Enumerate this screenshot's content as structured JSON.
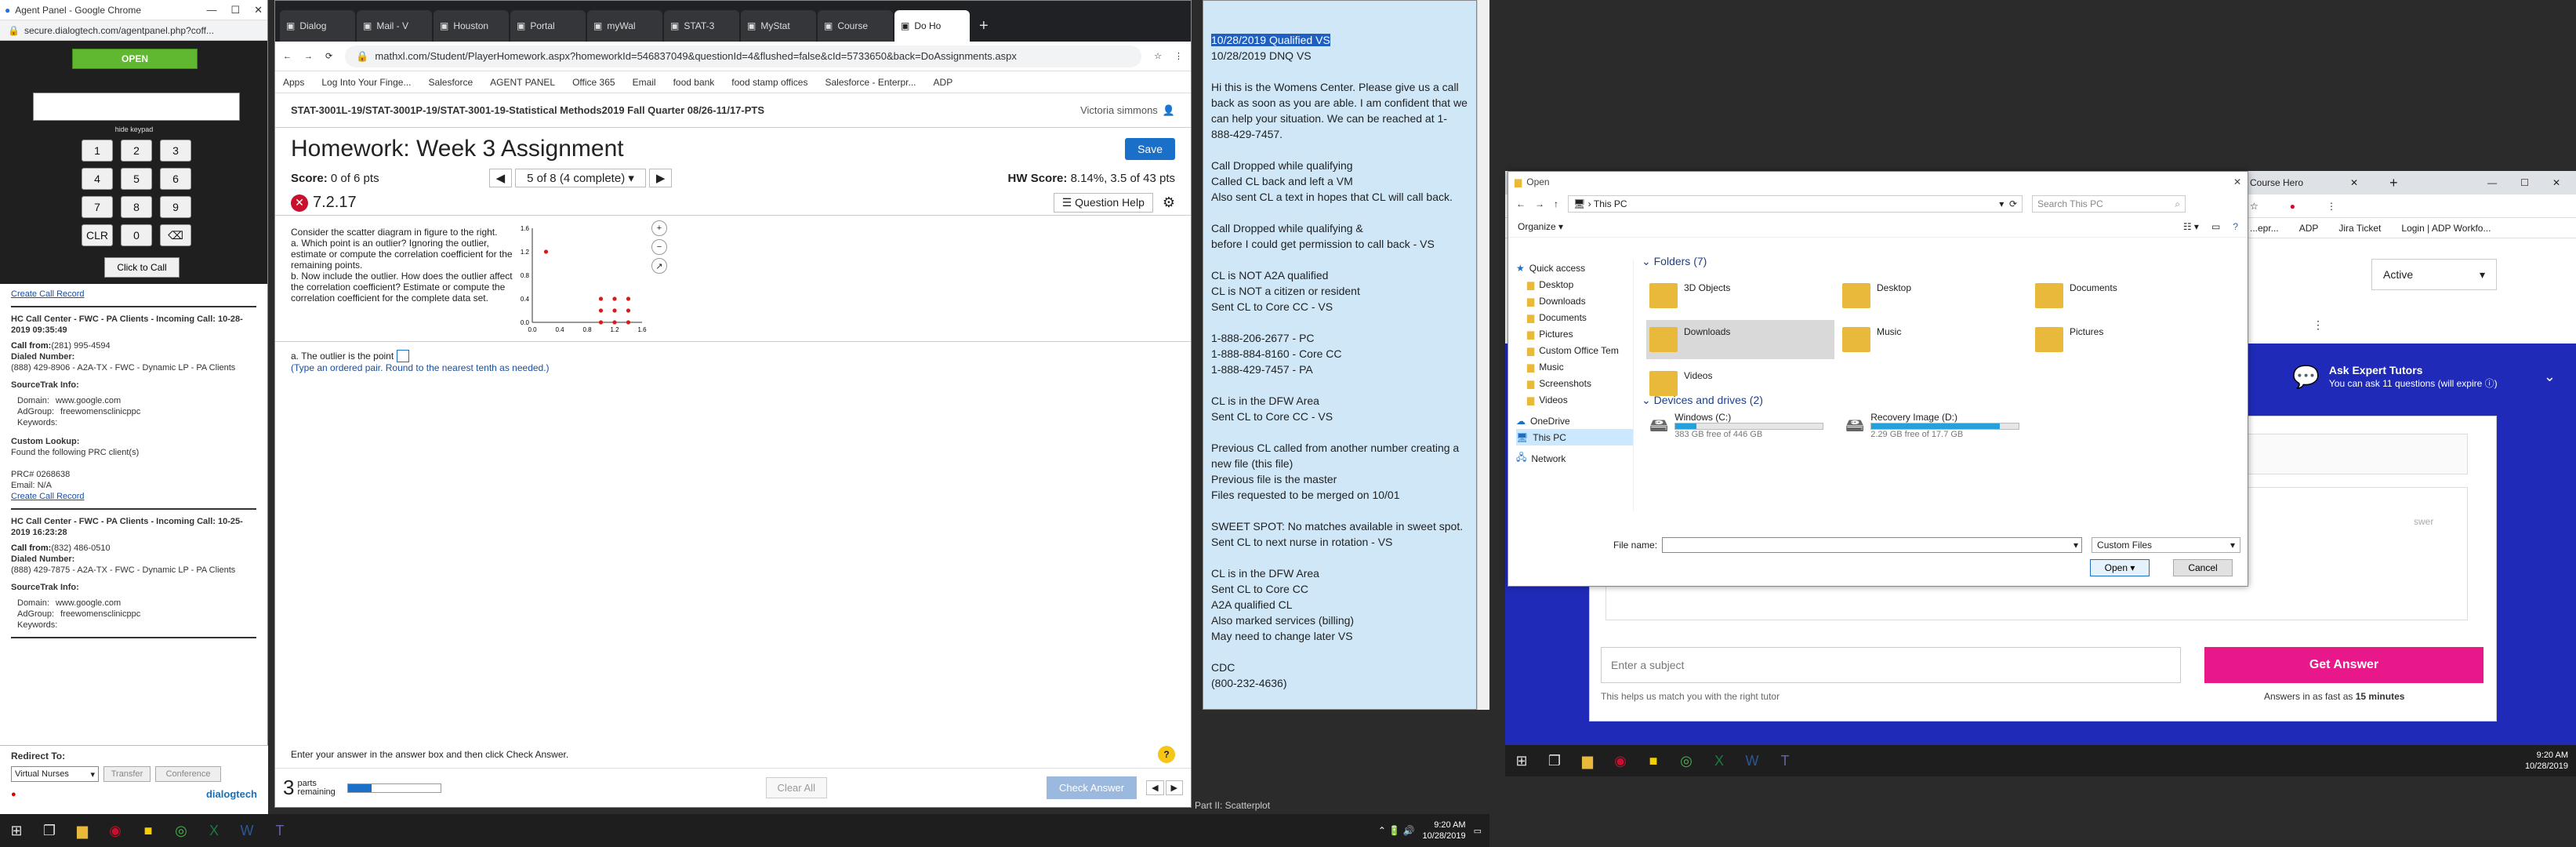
{
  "agent_panel": {
    "window_title": "Agent Panel - Google Chrome",
    "url": "secure.dialogtech.com/agentpanel.php?coff...",
    "open_button": "OPEN",
    "hide_keypad": "hide keypad",
    "keys": [
      "1",
      "2",
      "3",
      "4",
      "5",
      "6",
      "7",
      "8",
      "9",
      "CLR",
      "0",
      "⌫"
    ],
    "click_to_call": "Click to Call",
    "create_call_record_top": "Create Call Record",
    "calls": [
      {
        "header": "HC Call Center - FWC - PA Clients - Incoming Call: 10-28-2019 09:35:49",
        "call_from_label": "Call from:",
        "call_from": "(281) 995-4594",
        "dialed_label": "Dialed Number:",
        "dialed": "(888) 429-8906 - A2A-TX - FWC - Dynamic LP - PA Clients",
        "sourcetrak": "SourceTrak Info:",
        "domain_label": "Domain:",
        "domain": "www.google.com",
        "adgroup_label": "AdGroup:",
        "adgroup": "freewomensclinicppc",
        "keywords": "Keywords:",
        "custom_lookup": "Custom Lookup:",
        "lookup_result": "Found the following PRC client(s)",
        "prc": "PRC# 0268638",
        "email": "Email: N/A",
        "create": "Create Call Record"
      },
      {
        "header": "HC Call Center - FWC - PA Clients - Incoming Call: 10-25-2019 16:23:28",
        "call_from_label": "Call from:",
        "call_from": "(832) 486-0510",
        "dialed_label": "Dialed Number:",
        "dialed": "(888) 429-7875 - A2A-TX - FWC - Dynamic LP - PA Clients",
        "sourcetrak": "SourceTrak Info:",
        "domain_label": "Domain:",
        "domain": "www.google.com",
        "adgroup_label": "AdGroup:",
        "adgroup": "freewomensclinicppc",
        "keywords": "Keywords:"
      }
    ],
    "redirect_label": "Redirect To:",
    "redirect_value": "Virtual Nurses",
    "transfer": "Transfer",
    "conference": "Conference",
    "brand": "dialogtech"
  },
  "browser": {
    "tabs": [
      "Dialog",
      "Mail - V",
      "Houston",
      "Portal",
      "myWal",
      "STAT-3",
      "MyStat",
      "Course",
      "Do Ho"
    ],
    "url": "mathxl.com/Student/PlayerHomework.aspx?homeworkId=546837049&questionId=4&flushed=false&cId=5733650&back=DoAssignments.aspx",
    "bookmarks": [
      "Apps",
      "Log Into Your Finge...",
      "Salesforce",
      "AGENT PANEL",
      "Office 365",
      "Email",
      "food bank",
      "food stamp offices",
      "Salesforce - Enterpr...",
      "ADP"
    ],
    "course": "STAT-3001L-19/STAT-3001P-19/STAT-3001-19-Statistical Methods2019 Fall Quarter 08/26-11/17-PTS",
    "user": "Victoria simmons",
    "title": "Homework: Week 3 Assignment",
    "save": "Save",
    "score_label": "Score:",
    "score": "0 of 6 pts",
    "progress": "5 of 8 (4 complete)",
    "hw_score_label": "HW Score:",
    "hw_score": "8.14%, 3.5 of 43 pts",
    "question_id": "7.2.17",
    "question_help": "Question Help",
    "question_text": "Consider the scatter diagram in figure to the right.",
    "part_a": "a. Which point is an outlier? Ignoring the outlier, estimate or compute the correlation coefficient for the remaining points.",
    "part_b": "b. Now include the outlier. How does the outlier affect the correlation coefficient? Estimate or compute the correlation coefficient for the complete data set.",
    "answer_label": "a. The outlier is the point",
    "answer_hint": "(Type an ordered pair. Round to the nearest tenth as needed.)",
    "footer_prompt": "Enter your answer in the answer box and then click Check Answer.",
    "parts_count": "3",
    "parts_label": "parts remaining",
    "clear_all": "Clear All",
    "check_answer": "Check Answer"
  },
  "chart_data": {
    "type": "scatter",
    "x": [
      0.2,
      1.0,
      1.2,
      1.4,
      1.0,
      1.2,
      1.4,
      1.0,
      1.2,
      1.4
    ],
    "y": [
      1.2,
      0.4,
      0.4,
      0.4,
      0.2,
      0.2,
      0.2,
      0.0,
      0.0,
      0.0
    ],
    "xticks": [
      "0.0",
      "0.4",
      "0.8",
      "1.2",
      "1.6"
    ],
    "yticks": [
      "0.0",
      "0.4",
      "0.8",
      "1.2",
      "1.6"
    ],
    "xlim": [
      0,
      1.6
    ],
    "ylim": [
      0,
      1.6
    ],
    "point_color": "#d81c1c"
  },
  "notes": {
    "highlight": "10/28/2019 Qualified VS",
    "lines": [
      "10/28/2019 DNQ VS",
      "",
      "Hi this is the Womens Center.  Please give us a call back as soon as you are able.  I am confident that we can help your situation.  We can be reached at 1-888-429-7457.",
      "",
      "Call Dropped while qualifying",
      "Called CL back and left a VM",
      "Also sent CL a text in hopes that CL will call back.",
      "",
      "Call Dropped while qualifying &",
      "before I could get permission to call back - VS",
      "",
      "CL is NOT A2A qualified",
      "CL is NOT a citizen or resident",
      "Sent CL to Core CC - VS",
      "",
      "1-888-206-2677 - PC",
      "1-888-884-8160 - Core CC",
      "1-888-429-7457 - PA",
      "",
      "CL is in the DFW Area",
      "Sent CL to Core CC - VS",
      "",
      "Previous CL called from another number creating a new file (this file)",
      "Previous file is the master",
      "Files requested to be merged on 10/01",
      "",
      "SWEET SPOT: No matches available in sweet spot.",
      "Sent CL to next nurse in rotation - VS",
      "",
      "CL is in the DFW Area",
      "Sent CL to Core CC",
      "A2A qualified CL",
      "Also marked services (billing)",
      "May need to change later VS",
      "",
      "CDC",
      "(800-232-4636)"
    ]
  },
  "coursehero": {
    "tab": "Course Hero",
    "bookmarks": [
      "...epr...",
      "ADP",
      "Jira Ticket",
      "Login | ADP Workfo..."
    ],
    "status_select": "Active",
    "expert_title": "Ask Expert Tutors",
    "expert_sub": "You can ask 11 questions (will expire",
    "subject_placeholder": "Enter a subject",
    "get_answer": "Get Answer",
    "tutor_hint": "This helps us match you with the right tutor",
    "fast_text": "Answers in as fast as",
    "fast_value": "15 minutes",
    "partial_text": "swer",
    "accent": "#e8178a",
    "banner": "#1f2bb8"
  },
  "open_dialog": {
    "title": "Open",
    "path": "This PC",
    "search_placeholder": "Search This PC",
    "organize": "Organize",
    "nav": [
      "Quick access",
      "Desktop",
      "Downloads",
      "Documents",
      "Pictures",
      "Custom Office Tem",
      "Music",
      "Screenshots",
      "Videos",
      "OneDrive",
      "This PC",
      "Network"
    ],
    "folders_header": "Folders (7)",
    "folders": [
      "3D Objects",
      "Desktop",
      "Documents",
      "Downloads",
      "Music",
      "Pictures",
      "Videos"
    ],
    "devices_header": "Devices and drives (2)",
    "drives": [
      {
        "name": "Windows (C:)",
        "free": "383 GB free of 446 GB",
        "used_fraction": 0.14
      },
      {
        "name": "Recovery Image (D:)",
        "free": "2.29 GB free of 17.7 GB",
        "used_fraction": 0.87
      }
    ],
    "filename_label": "File name:",
    "filter": "Custom Files",
    "open": "Open",
    "cancel": "Cancel"
  },
  "taskbar": {
    "left_time": "9:20 AM",
    "left_date": "10/28/2019",
    "right_time": "9:20 AM",
    "right_date": "10/28/2019",
    "peek_text": "Part II: Scatterplot"
  }
}
